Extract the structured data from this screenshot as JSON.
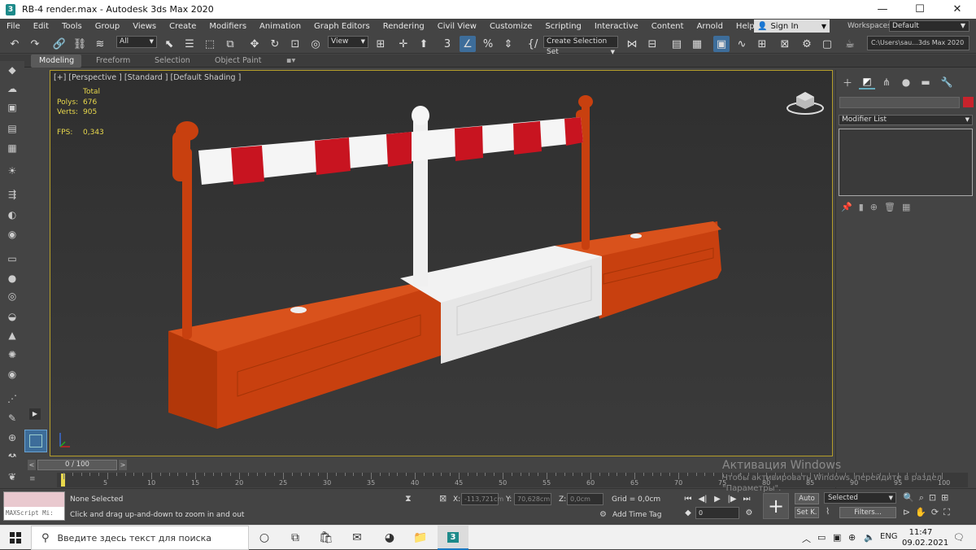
{
  "window": {
    "title": "RB-4 render.max - Autodesk 3ds Max 2020",
    "minimize": "—",
    "maximize": "☐",
    "close": "✕"
  },
  "menu": [
    "File",
    "Edit",
    "Tools",
    "Group",
    "Views",
    "Create",
    "Modifiers",
    "Animation",
    "Graph Editors",
    "Rendering",
    "Civil View",
    "Customize",
    "Scripting",
    "Interactive",
    "Content",
    "Arnold",
    "Help"
  ],
  "signin": {
    "label": "Sign In"
  },
  "workspaces": {
    "label": "Workspaces:",
    "value": "Default"
  },
  "toolbar": {
    "filter_value": "All",
    "refcoord_value": "View",
    "selection_set_value": "Create Selection Set",
    "project_path": "C:\\Users\\sau...3ds Max 2020"
  },
  "ribbon": {
    "tabs": [
      "Modeling",
      "Freeform",
      "Selection",
      "Object Paint"
    ]
  },
  "viewport": {
    "label": "[+] [Perspective ] [Standard ] [Default Shading ]",
    "stats": {
      "total_label": "Total",
      "polys_label": "Polys:",
      "polys_value": "676",
      "verts_label": "Verts:",
      "verts_value": "905",
      "fps_label": "FPS:",
      "fps_value": "0,343"
    }
  },
  "command_panel": {
    "modifier_list": "Modifier List",
    "object_color": "#c8232c"
  },
  "timeline": {
    "slider": "0 / 100",
    "ticks": [
      "0",
      "5",
      "10",
      "15",
      "20",
      "25",
      "30",
      "35",
      "40",
      "45",
      "50",
      "55",
      "60",
      "65",
      "70",
      "75",
      "80",
      "85",
      "90",
      "95",
      "100"
    ]
  },
  "status": {
    "maxscript": "MAXScript Mi:",
    "selection": "None Selected",
    "prompt": "Click and drag up-and-down to zoom in and out",
    "x_label": "X:",
    "x_value": "-113,721cm",
    "y_label": "Y:",
    "y_value": "70,628cm",
    "z_label": "Z:",
    "z_value": "0,0cm",
    "grid": "Grid = 0,0cm",
    "add_time_tag": "Add Time Tag",
    "frame_value": "0",
    "auto_label": "Auto",
    "setk_label": "Set K.",
    "selected_value": "Selected",
    "filters_label": "Filters..."
  },
  "watermark": {
    "line1": "Активация Windows",
    "line2": "Чтобы активировать Windows, перейдите в раздел",
    "line3": "\"Параметры\"."
  },
  "taskbar": {
    "search_placeholder": "Введите здесь текст для поиска",
    "language": "ENG",
    "time": "11:47",
    "date": "09.02.2021"
  },
  "colors": {
    "barrier_orange": "#c8400f",
    "barrier_white": "#f2f2f2",
    "stripe_red": "#c81420",
    "viewport_border": "#b59e2a",
    "stats_yellow": "#e8d84c"
  }
}
